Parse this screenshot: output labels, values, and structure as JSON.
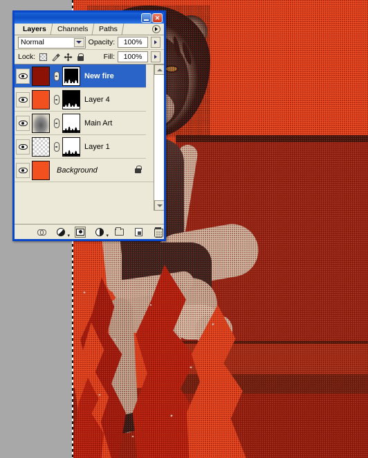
{
  "app": {
    "palette_title": "",
    "window_controls": {
      "minimize": "−",
      "close": "✕"
    }
  },
  "tabs": [
    {
      "label": "Layers",
      "active": true
    },
    {
      "label": "Channels",
      "active": false
    },
    {
      "label": "Paths",
      "active": false
    }
  ],
  "palette_menu": {
    "name": "palette-menu",
    "glyph": "▸"
  },
  "blend": {
    "mode": "Normal",
    "opacity_label": "Opacity:",
    "opacity_value": "100%"
  },
  "lock": {
    "label": "Lock:",
    "icons": [
      "lock-transparency-icon",
      "lock-image-icon",
      "lock-position-icon",
      "lock-all-icon"
    ],
    "fill_label": "Fill:",
    "fill_value": "100%"
  },
  "layers": [
    {
      "name": "New fire",
      "selected": true,
      "visible": true,
      "italic": false,
      "thumb_type": "solid",
      "thumb_color": "#8c1206",
      "mask_type": "black-flames",
      "locked": false
    },
    {
      "name": "Layer 4",
      "selected": false,
      "visible": true,
      "italic": false,
      "thumb_type": "solid",
      "thumb_color": "#f2501e",
      "mask_type": "black-flames",
      "locked": false
    },
    {
      "name": "Main Art",
      "selected": false,
      "visible": true,
      "italic": false,
      "thumb_type": "art",
      "thumb_color": "#9a9488",
      "mask_type": "white-flames",
      "locked": false
    },
    {
      "name": "Layer 1",
      "selected": false,
      "visible": true,
      "italic": false,
      "thumb_type": "checker",
      "thumb_color": "#e5e0cf",
      "mask_type": "white-flames",
      "locked": false
    },
    {
      "name": "Background",
      "selected": false,
      "visible": true,
      "italic": true,
      "thumb_type": "solid",
      "thumb_color": "#f2501e",
      "mask_type": "none",
      "locked": true
    }
  ],
  "scrollbar": {
    "up": "▲",
    "down": "▼"
  },
  "bottom_toolbar": [
    {
      "name": "link-layers-button",
      "icon": "link-icon"
    },
    {
      "name": "layer-style-button",
      "icon": "fx-icon"
    },
    {
      "name": "add-layer-mask-button",
      "icon": "mask-icon"
    },
    {
      "name": "new-adjustment-layer-button",
      "icon": "adjustment-icon"
    },
    {
      "name": "new-group-button",
      "icon": "folder-icon"
    },
    {
      "name": "new-layer-button",
      "icon": "new-layer-icon"
    },
    {
      "name": "delete-layer-button",
      "icon": "trash-icon"
    }
  ],
  "artwork": {
    "title": "tiger-headed-figure-on-couch-with-flames",
    "palette": {
      "background_orange": "#e8441c",
      "wall_dark_red": "#8e2012",
      "flame_dark_red": "#9c1408",
      "flame_mid_red": "#b31a09",
      "ink_black": "#141414",
      "paper_cream": "#cfc9b6"
    },
    "elements": [
      "tiger-head",
      "seated-figure",
      "couch",
      "flames",
      "halftone-texture"
    ]
  },
  "canvas": {
    "selection_marquee": true,
    "desktop_gray": "#a8a8a8"
  }
}
